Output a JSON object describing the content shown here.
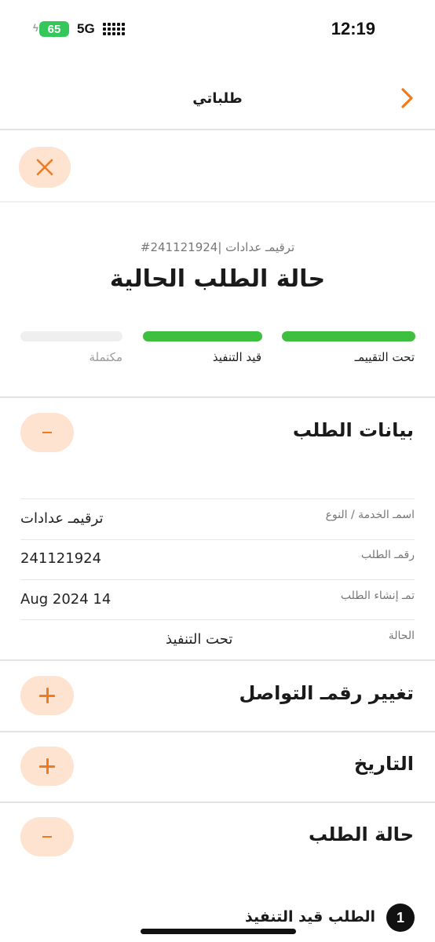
{
  "status_bar": {
    "time": "12:19",
    "battery_level": "65",
    "network": "5G",
    "icons": [
      "charging-bolt-icon",
      "battery-icon",
      "signal-icon"
    ]
  },
  "header": {
    "title": "طلباتي",
    "back_icon": "chevron-right-icon"
  },
  "close_button": {
    "icon": "close-x-icon"
  },
  "status_card": {
    "order_number": "ترقيمـ عدادات |241121924#",
    "title": "حالة الطلب الحالية",
    "steps": [
      {
        "label": "تحت التقييمـ",
        "progress": 1.0,
        "color": "#3fbf3f"
      },
      {
        "label": "قيد التنفيذ",
        "progress": 1.0,
        "color": "#3fbf3f"
      },
      {
        "label": "مكتملة",
        "progress": 0.0,
        "color": "#efefef"
      }
    ]
  },
  "order_details": {
    "title": "بيانات الطلب",
    "expanded": true,
    "rows": [
      {
        "label": "اسمـ الخدمة / النوع",
        "value": "ترقيمـ عدادات"
      },
      {
        "label": "رقمـ الطلب",
        "value": "241121924"
      },
      {
        "label": "تمـ إنشاء الطلب",
        "value": "Aug 2024 14"
      },
      {
        "label": "الحالة",
        "value": "تحت التنفيذ"
      }
    ]
  },
  "change_contact": {
    "title": "تغيير رقمـ التواصل",
    "expanded": false
  },
  "history": {
    "title": "التاريخ",
    "expanded": false
  },
  "order_status": {
    "title": "حالة الطلب",
    "expanded": true,
    "timeline": [
      {
        "number": "1",
        "text": "الطلب قيد التنفيذ"
      }
    ]
  },
  "colors": {
    "accent": "#f07b1e",
    "accent_bg": "#fde3d0",
    "progress_done": "#3fbf3f",
    "progress_pending": "#efefef",
    "muted_text": "#777777"
  }
}
